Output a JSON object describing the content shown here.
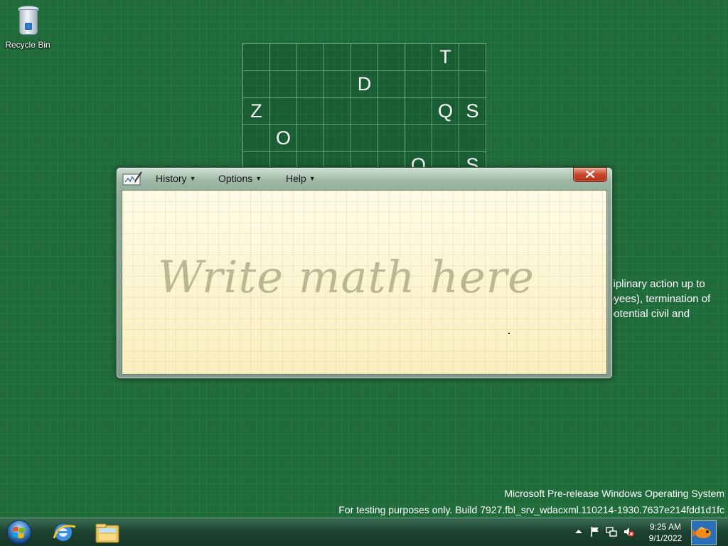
{
  "desktop": {
    "recycle_bin_label": "Recycle Bin",
    "letter_grid": [
      [
        "",
        "",
        "",
        "",
        "",
        "",
        "",
        "T",
        ""
      ],
      [
        "",
        "",
        "",
        "",
        "D",
        "",
        "",
        "",
        ""
      ],
      [
        "Z",
        "",
        "",
        "",
        "",
        "",
        "",
        "Q",
        "S"
      ],
      [
        "",
        "O",
        "",
        "",
        "",
        "",
        "",
        "",
        ""
      ],
      [
        "",
        "",
        "",
        "",
        "",
        "",
        "O",
        "",
        "S"
      ]
    ],
    "policy_text": [
      "ciplinary action up to",
      "oyees), termination of",
      "potential civil and"
    ],
    "watermark_line1": "Microsoft Pre-release Windows Operating System",
    "watermark_line2": "For testing purposes only. Build 7927.fbl_srv_wdacxml.110214-1930.7637e214fdd1d1fc"
  },
  "math_input_panel": {
    "menu": {
      "history": "History",
      "options": "Options",
      "help": "Help"
    },
    "hint_text": "Write math here",
    "close_icon": "close-x-icon"
  },
  "taskbar": {
    "start_icon": "windows-orb-icon",
    "pinned": [
      "internet-explorer-icon",
      "windows-explorer-icon"
    ],
    "tray_icons": [
      "show-hidden-icons-arrow",
      "action-center-flag-icon",
      "network-icon",
      "volume-muted-icon"
    ],
    "clock_time": "9:25 AM",
    "clock_date": "9/1/2022"
  },
  "colors": {
    "desktop_green": "#1f6b3a",
    "pad_yellow": "#fdf7d6",
    "close_red": "#c9472c"
  }
}
